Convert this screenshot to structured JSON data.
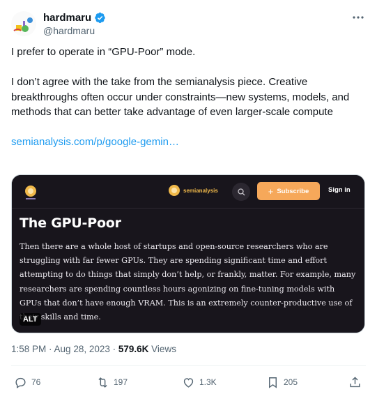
{
  "author": {
    "display_name": "hardmaru",
    "handle": "@hardmaru",
    "verified": true,
    "avatar_icon": "avatar-illustration"
  },
  "tweet": {
    "line1": "I prefer to operate in “GPU-Poor” mode.",
    "line2": "I don’t agree with the take from the semianalysis piece. Creative breakthroughs often occur under constraints—new systems, models, and methods that can better take advantage of even larger-scale compute",
    "link_text": "semianalysis.com/p/google-gemin…"
  },
  "media": {
    "brand_text": "semianalysis",
    "subscribe_label": "Subscribe",
    "signin_label": "Sign in",
    "title": "The GPU-Poor",
    "body": "Then there are a whole host of startups and open-source researchers who are struggling with far fewer GPUs. They are spending significant time and effort attempting to do things that simply don’t help, or frankly, matter. For example, many researchers are spending countless hours agonizing on fine-tuning models with GPUs that don’t have enough VRAM. This is an extremely counter-productive use of their skills and time.",
    "alt_label": "ALT",
    "accent_color": "#f6a85a"
  },
  "meta": {
    "time": "1:58 PM",
    "dot1": " · ",
    "date": "Aug 28, 2023",
    "dot2": " · ",
    "views_count": "579.6K",
    "views_label": " Views"
  },
  "actions": {
    "replies": "76",
    "reposts": "197",
    "likes": "1.3K",
    "bookmarks": "205"
  }
}
